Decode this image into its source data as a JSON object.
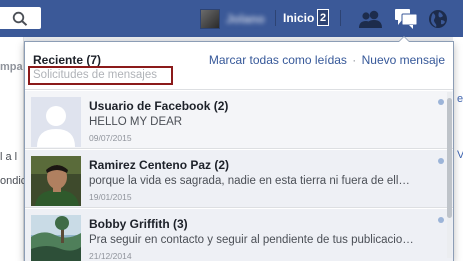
{
  "topbar": {
    "user_name": "Jolano",
    "home_label": "Inicio",
    "home_count": "2",
    "icons": [
      "search-icon",
      "friend-requests-icon",
      "messages-icon",
      "notifications-globe-icon"
    ]
  },
  "background": {
    "left_fragments": [
      "mpa",
      "l a l",
      "ondic"
    ],
    "right_fragments": [
      "e",
      "V"
    ]
  },
  "dropdown": {
    "title": "Reciente (7)",
    "mark_all_read": "Marcar todas como leídas",
    "separator": "·",
    "new_message": "Nuevo mensaje",
    "requests_label": "Solicitudes de mensajes"
  },
  "messages": [
    {
      "name": "Usuario de Facebook (2)",
      "text": "HELLO MY DEAR",
      "date": "09/07/2015",
      "avatar": "default-silhouette"
    },
    {
      "name": "Ramirez Centeno Paz (2)",
      "text": "porque la vida es sagrada, nadie en esta tierra ni fuera de ell…",
      "date": "19/01/2015",
      "avatar": "photo-man-green"
    },
    {
      "name": "Bobby Griffith (3)",
      "text": "Pra seguir en contacto y seguir al pendiente de tus publicacio…",
      "date": "21/12/2014",
      "avatar": "photo-landscape"
    }
  ],
  "colors": {
    "brand": "#3b5998",
    "link": "#365899",
    "highlight_box": "#8b1a1a",
    "unread_dot": "#9cb4d8"
  }
}
